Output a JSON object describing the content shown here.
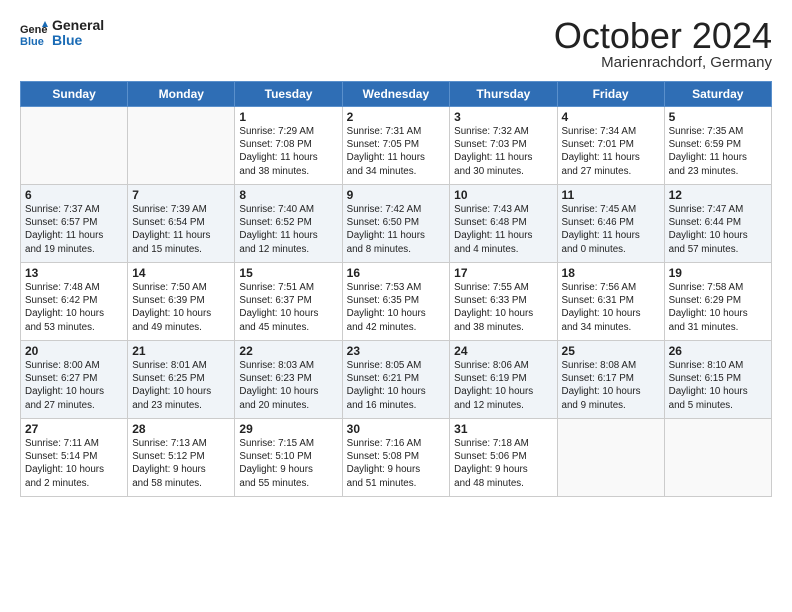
{
  "header": {
    "logo_line1": "General",
    "logo_line2": "Blue",
    "month": "October 2024",
    "location": "Marienrachdorf, Germany"
  },
  "weekdays": [
    "Sunday",
    "Monday",
    "Tuesday",
    "Wednesday",
    "Thursday",
    "Friday",
    "Saturday"
  ],
  "weeks": [
    [
      {
        "day": "",
        "info": ""
      },
      {
        "day": "",
        "info": ""
      },
      {
        "day": "1",
        "info": "Sunrise: 7:29 AM\nSunset: 7:08 PM\nDaylight: 11 hours\nand 38 minutes."
      },
      {
        "day": "2",
        "info": "Sunrise: 7:31 AM\nSunset: 7:05 PM\nDaylight: 11 hours\nand 34 minutes."
      },
      {
        "day": "3",
        "info": "Sunrise: 7:32 AM\nSunset: 7:03 PM\nDaylight: 11 hours\nand 30 minutes."
      },
      {
        "day": "4",
        "info": "Sunrise: 7:34 AM\nSunset: 7:01 PM\nDaylight: 11 hours\nand 27 minutes."
      },
      {
        "day": "5",
        "info": "Sunrise: 7:35 AM\nSunset: 6:59 PM\nDaylight: 11 hours\nand 23 minutes."
      }
    ],
    [
      {
        "day": "6",
        "info": "Sunrise: 7:37 AM\nSunset: 6:57 PM\nDaylight: 11 hours\nand 19 minutes."
      },
      {
        "day": "7",
        "info": "Sunrise: 7:39 AM\nSunset: 6:54 PM\nDaylight: 11 hours\nand 15 minutes."
      },
      {
        "day": "8",
        "info": "Sunrise: 7:40 AM\nSunset: 6:52 PM\nDaylight: 11 hours\nand 12 minutes."
      },
      {
        "day": "9",
        "info": "Sunrise: 7:42 AM\nSunset: 6:50 PM\nDaylight: 11 hours\nand 8 minutes."
      },
      {
        "day": "10",
        "info": "Sunrise: 7:43 AM\nSunset: 6:48 PM\nDaylight: 11 hours\nand 4 minutes."
      },
      {
        "day": "11",
        "info": "Sunrise: 7:45 AM\nSunset: 6:46 PM\nDaylight: 11 hours\nand 0 minutes."
      },
      {
        "day": "12",
        "info": "Sunrise: 7:47 AM\nSunset: 6:44 PM\nDaylight: 10 hours\nand 57 minutes."
      }
    ],
    [
      {
        "day": "13",
        "info": "Sunrise: 7:48 AM\nSunset: 6:42 PM\nDaylight: 10 hours\nand 53 minutes."
      },
      {
        "day": "14",
        "info": "Sunrise: 7:50 AM\nSunset: 6:39 PM\nDaylight: 10 hours\nand 49 minutes."
      },
      {
        "day": "15",
        "info": "Sunrise: 7:51 AM\nSunset: 6:37 PM\nDaylight: 10 hours\nand 45 minutes."
      },
      {
        "day": "16",
        "info": "Sunrise: 7:53 AM\nSunset: 6:35 PM\nDaylight: 10 hours\nand 42 minutes."
      },
      {
        "day": "17",
        "info": "Sunrise: 7:55 AM\nSunset: 6:33 PM\nDaylight: 10 hours\nand 38 minutes."
      },
      {
        "day": "18",
        "info": "Sunrise: 7:56 AM\nSunset: 6:31 PM\nDaylight: 10 hours\nand 34 minutes."
      },
      {
        "day": "19",
        "info": "Sunrise: 7:58 AM\nSunset: 6:29 PM\nDaylight: 10 hours\nand 31 minutes."
      }
    ],
    [
      {
        "day": "20",
        "info": "Sunrise: 8:00 AM\nSunset: 6:27 PM\nDaylight: 10 hours\nand 27 minutes."
      },
      {
        "day": "21",
        "info": "Sunrise: 8:01 AM\nSunset: 6:25 PM\nDaylight: 10 hours\nand 23 minutes."
      },
      {
        "day": "22",
        "info": "Sunrise: 8:03 AM\nSunset: 6:23 PM\nDaylight: 10 hours\nand 20 minutes."
      },
      {
        "day": "23",
        "info": "Sunrise: 8:05 AM\nSunset: 6:21 PM\nDaylight: 10 hours\nand 16 minutes."
      },
      {
        "day": "24",
        "info": "Sunrise: 8:06 AM\nSunset: 6:19 PM\nDaylight: 10 hours\nand 12 minutes."
      },
      {
        "day": "25",
        "info": "Sunrise: 8:08 AM\nSunset: 6:17 PM\nDaylight: 10 hours\nand 9 minutes."
      },
      {
        "day": "26",
        "info": "Sunrise: 8:10 AM\nSunset: 6:15 PM\nDaylight: 10 hours\nand 5 minutes."
      }
    ],
    [
      {
        "day": "27",
        "info": "Sunrise: 7:11 AM\nSunset: 5:14 PM\nDaylight: 10 hours\nand 2 minutes."
      },
      {
        "day": "28",
        "info": "Sunrise: 7:13 AM\nSunset: 5:12 PM\nDaylight: 9 hours\nand 58 minutes."
      },
      {
        "day": "29",
        "info": "Sunrise: 7:15 AM\nSunset: 5:10 PM\nDaylight: 9 hours\nand 55 minutes."
      },
      {
        "day": "30",
        "info": "Sunrise: 7:16 AM\nSunset: 5:08 PM\nDaylight: 9 hours\nand 51 minutes."
      },
      {
        "day": "31",
        "info": "Sunrise: 7:18 AM\nSunset: 5:06 PM\nDaylight: 9 hours\nand 48 minutes."
      },
      {
        "day": "",
        "info": ""
      },
      {
        "day": "",
        "info": ""
      }
    ]
  ]
}
